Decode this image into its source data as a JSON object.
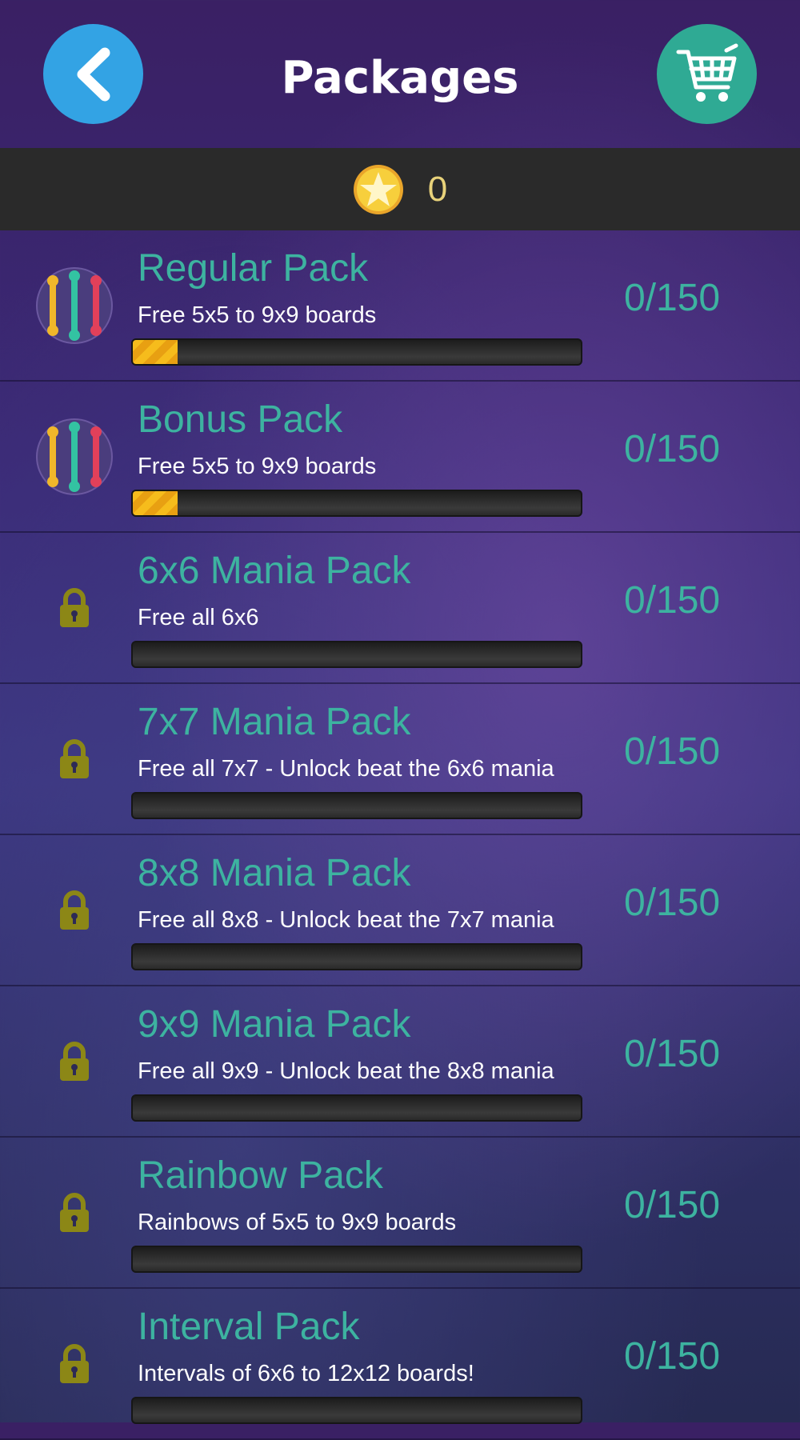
{
  "header": {
    "title": "Packages",
    "back_icon": "chevron-left-icon",
    "cart_icon": "shopping-cart-icon"
  },
  "coins": {
    "icon": "star-coin-icon",
    "value": "0"
  },
  "colors": {
    "back_button": "#33a3e4",
    "cart_button": "#2faa94",
    "accent": "#3db3a0",
    "lock": "#8c8716",
    "progress": "#f6bc1c"
  },
  "packs": [
    {
      "name": "Regular Pack",
      "description": "Free 5x5 to 9x9 boards",
      "count": "0/150",
      "locked": false,
      "icon": "pack-lines-icon",
      "progress": 0.1
    },
    {
      "name": "Bonus Pack",
      "description": "Free 5x5 to 9x9 boards",
      "count": "0/150",
      "locked": false,
      "icon": "pack-lines-icon",
      "progress": 0.1
    },
    {
      "name": "6x6 Mania Pack",
      "description": "Free all 6x6",
      "count": "0/150",
      "locked": true,
      "icon": "lock-icon",
      "progress": 0
    },
    {
      "name": "7x7 Mania Pack",
      "description": "Free all 7x7 - Unlock beat the 6x6 mania",
      "count": "0/150",
      "locked": true,
      "icon": "lock-icon",
      "progress": 0
    },
    {
      "name": "8x8 Mania Pack",
      "description": "Free all 8x8 - Unlock beat the 7x7 mania",
      "count": "0/150",
      "locked": true,
      "icon": "lock-icon",
      "progress": 0
    },
    {
      "name": "9x9 Mania Pack",
      "description": "Free all 9x9 - Unlock beat the 8x8 mania",
      "count": "0/150",
      "locked": true,
      "icon": "lock-icon",
      "progress": 0
    },
    {
      "name": "Rainbow Pack",
      "description": "Rainbows of 5x5 to 9x9 boards",
      "count": "0/150",
      "locked": true,
      "icon": "lock-icon",
      "progress": 0
    },
    {
      "name": "Interval Pack",
      "description": "Intervals of 6x6 to 12x12 boards!",
      "count": "0/150",
      "locked": true,
      "icon": "lock-icon",
      "progress": 0
    }
  ]
}
